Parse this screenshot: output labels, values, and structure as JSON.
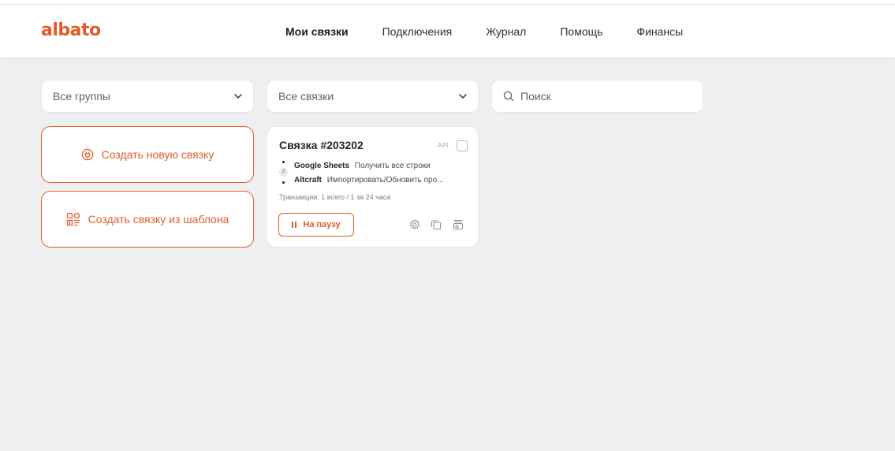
{
  "brand": {
    "name": "albato",
    "accent": "#e35b2c"
  },
  "nav": {
    "items": [
      {
        "label": "Мои связки",
        "active": true
      },
      {
        "label": "Подключения",
        "active": false
      },
      {
        "label": "Журнал",
        "active": false
      },
      {
        "label": "Помощь",
        "active": false
      },
      {
        "label": "Финансы",
        "active": false
      }
    ]
  },
  "filters": {
    "groups": {
      "value": "Все группы",
      "icon": "chevron-down-icon"
    },
    "bundles": {
      "value": "Все связки",
      "icon": "chevron-down-icon"
    },
    "search": {
      "placeholder": "Поиск",
      "icon": "search-icon"
    }
  },
  "actions": {
    "create_new": {
      "label": "Создать новую связку",
      "icon": "plug-icon"
    },
    "create_from_template": {
      "label": "Создать связку из шаблона",
      "icon": "template-icon"
    }
  },
  "bundle_card": {
    "title": "Связка #203202",
    "api_tag": "API",
    "step_count": "2",
    "steps": [
      {
        "app": "Google Sheets",
        "action": "Получить все строки"
      },
      {
        "app": "Altcraft",
        "action": "Импортировать/Обновить про..."
      }
    ],
    "transactions": "Транзакции: 1 всего / 1 за 24 часа",
    "pause_label": "На паузу",
    "icons": [
      "settings-icon",
      "copy-icon",
      "archive-icon"
    ]
  }
}
